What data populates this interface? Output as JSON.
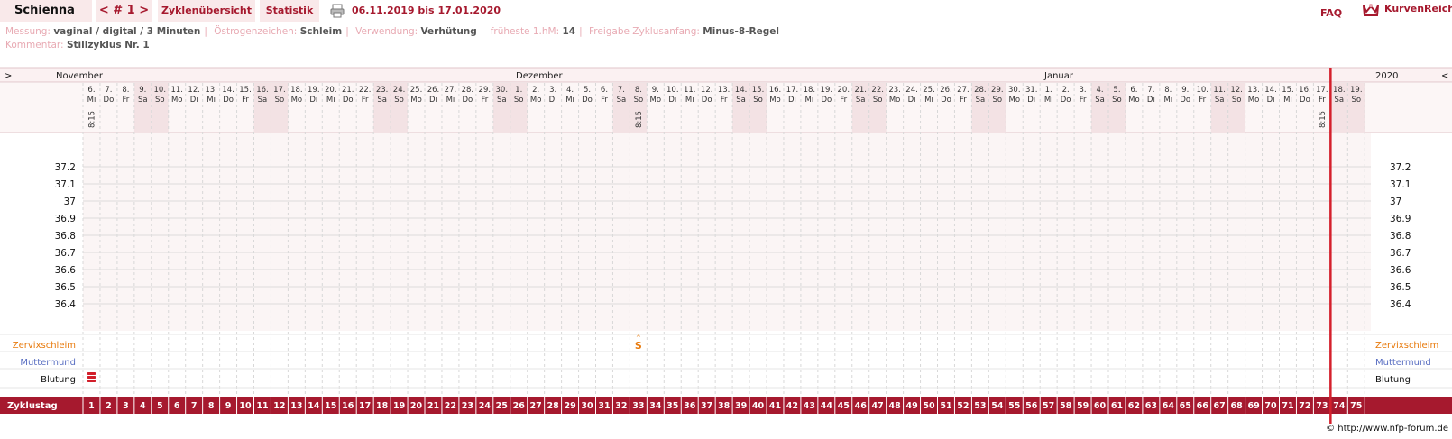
{
  "header": {
    "user_name": "Schienna",
    "cycle_nav": "< # 1 >",
    "tab_overview": "Zyklenübersicht",
    "tab_stats": "Statistik",
    "date_range": "06.11.2019 bis 17.01.2020",
    "faq": "FAQ",
    "brand": "KurvenReich"
  },
  "info": {
    "measurement_key": "Messung:",
    "measurement": "vaginal / digital / 3 Minuten",
    "estrogen_key": "Östrogenzeichen:",
    "estrogen": "Schleim",
    "usage_key": "Verwendung:",
    "usage": "Verhütung",
    "earliest_key": "früheste 1.hM:",
    "earliest": "14",
    "release_key": "Freigabe Zyklusanfang:",
    "release": "Minus-8-Regel",
    "comment_key": "Kommentar:",
    "comment": "Stillzyklus Nr. 1"
  },
  "chart_data": {
    "type": "line",
    "months": [
      {
        "name": "November",
        "start_day": 1
      },
      {
        "name": "Dezember",
        "start_day": 26
      },
      {
        "name": "Januar",
        "start_day": 57
      }
    ],
    "year_label": "2020",
    "nav_left": ">",
    "nav_right": "<",
    "dates": [
      "6.",
      "7.",
      "8.",
      "9.",
      "10.",
      "11.",
      "12.",
      "13.",
      "14.",
      "15.",
      "16.",
      "17.",
      "18.",
      "19.",
      "20.",
      "21.",
      "22.",
      "23.",
      "24.",
      "25.",
      "26.",
      "27.",
      "28.",
      "29.",
      "30.",
      "1.",
      "2.",
      "3.",
      "4.",
      "5.",
      "6.",
      "7.",
      "8.",
      "9.",
      "10.",
      "11.",
      "12.",
      "13.",
      "14.",
      "15.",
      "16.",
      "17.",
      "18.",
      "19.",
      "20.",
      "21.",
      "22.",
      "23.",
      "24.",
      "25.",
      "26.",
      "27.",
      "28.",
      "29.",
      "30.",
      "31.",
      "1.",
      "2.",
      "3.",
      "4.",
      "5.",
      "6.",
      "7.",
      "8.",
      "9.",
      "10.",
      "11.",
      "12.",
      "13.",
      "14.",
      "15.",
      "16.",
      "17.",
      "18.",
      "19."
    ],
    "weekdays": [
      "Mi",
      "Do",
      "Fr",
      "Sa",
      "So",
      "Mo",
      "Di",
      "Mi",
      "Do",
      "Fr",
      "Sa",
      "So",
      "Mo",
      "Di",
      "Mi",
      "Do",
      "Fr",
      "Sa",
      "So",
      "Mo",
      "Di",
      "Mi",
      "Do",
      "Fr",
      "Sa",
      "So",
      "Mo",
      "Di",
      "Mi",
      "Do",
      "Fr",
      "Sa",
      "So",
      "Mo",
      "Di",
      "Mi",
      "Do",
      "Fr",
      "Sa",
      "So",
      "Mo",
      "Di",
      "Mi",
      "Do",
      "Fr",
      "Sa",
      "So",
      "Mo",
      "Di",
      "Mi",
      "Do",
      "Fr",
      "Sa",
      "So",
      "Mo",
      "Di",
      "Mi",
      "Do",
      "Fr",
      "Sa",
      "So",
      "Mo",
      "Di",
      "Mi",
      "Do",
      "Fr",
      "Sa",
      "So",
      "Mo",
      "Di",
      "Mi",
      "Do",
      "Fr",
      "Sa",
      "So"
    ],
    "times": [
      {
        "day": 1,
        "time": "8:15"
      },
      {
        "day": 33,
        "time": "8:15"
      },
      {
        "day": 73,
        "time": "8:15"
      }
    ],
    "y_ticks": [
      "37.2",
      "37.1",
      "37",
      "36.9",
      "36.8",
      "36.7",
      "36.6",
      "36.5",
      "36.4"
    ],
    "rows": {
      "cervix": "Zervixschleim",
      "cervix_mark": "S",
      "muttermund": "Muttermund",
      "bleeding": "Blutung",
      "cycle_day": "Zyklustag"
    },
    "cervix_mark_day": 33,
    "bleeding": [
      {
        "day": 1,
        "level": "heavy"
      }
    ],
    "cycle_days": [
      "1",
      "2",
      "3",
      "4",
      "5",
      "6",
      "7",
      "8",
      "9",
      "10",
      "11",
      "12",
      "13",
      "14",
      "15",
      "16",
      "17",
      "18",
      "19",
      "20",
      "21",
      "22",
      "23",
      "24",
      "25",
      "26",
      "27",
      "28",
      "29",
      "30",
      "31",
      "32",
      "33",
      "34",
      "35",
      "36",
      "37",
      "38",
      "39",
      "40",
      "41",
      "42",
      "43",
      "44",
      "45",
      "46",
      "47",
      "48",
      "49",
      "50",
      "51",
      "52",
      "53",
      "54",
      "55",
      "56",
      "57",
      "58",
      "59",
      "60",
      "61",
      "62",
      "63",
      "64",
      "65",
      "66",
      "67",
      "68",
      "69",
      "70",
      "71",
      "72",
      "73",
      "74",
      "75"
    ],
    "current_day": 73,
    "colors": {
      "accent": "#a6192e",
      "weekend": "#f3e2e4",
      "cervix": "#e87a0c",
      "muttermund": "#5a6fc2",
      "grid": "#dcdcdc"
    }
  },
  "footer": "© http://www.nfp-forum.de"
}
